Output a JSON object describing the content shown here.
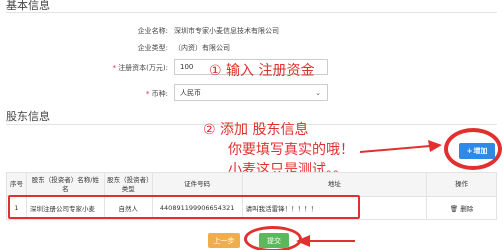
{
  "basic_info": {
    "title": "基本信息",
    "company_name_label": "企业名称:",
    "company_name_value": "深圳市专家小麦信息技术有限公司",
    "company_type_label": "企业类型:",
    "company_type_value": "（内资）有限公司",
    "capital_label": "注册资本(万元):",
    "capital_value": "100",
    "currency_label": "币种:",
    "currency_value": "人民币"
  },
  "shareholder": {
    "title": "股东信息",
    "add_button_label": "增加",
    "columns": [
      "序号",
      "股东（投资者）名称/姓名",
      "股东（投资者）类型",
      "证件号码",
      "地址",
      "操作"
    ],
    "rows": [
      {
        "index": "1",
        "name": "深圳注册公司专家小麦",
        "type": "自然人",
        "id_number": "440891199906654321",
        "address": "请叫我活雷锋！！！！！",
        "action": "删除"
      }
    ]
  },
  "annotations": {
    "note1": "① 输入 注册资金",
    "note2": "② 添加 股东信息",
    "note3": "你要填写真实的哦！",
    "note4": "小麦这只是测试。。"
  },
  "footer": {
    "prev_label": "上一步",
    "submit_label": "提交"
  },
  "colors": {
    "primary": "#2e8ae6",
    "annotation_red": "#e0312f",
    "warning": "#f0ad4e",
    "success": "#5cb85c"
  }
}
